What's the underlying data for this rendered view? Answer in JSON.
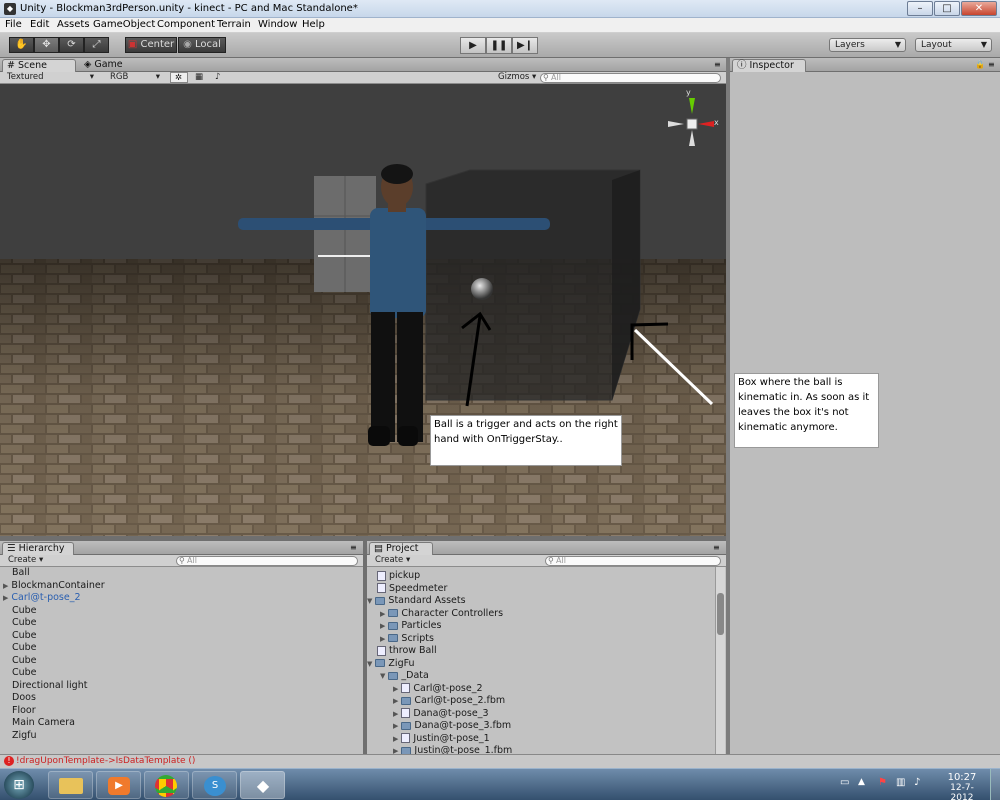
{
  "window": {
    "title": "Unity - Blockman3rdPerson.unity - kinect - PC and Mac Standalone*",
    "buttons": {
      "minimize": "–",
      "maximize": "□",
      "close": "✕"
    }
  },
  "menu": [
    "File",
    "Edit",
    "Assets",
    "GameObject",
    "Component",
    "Terrain",
    "Window",
    "Help"
  ],
  "toolbar": {
    "pivot_label": "Center",
    "space_label": "Local",
    "layers_label": "Layers",
    "layout_label": "Layout"
  },
  "scene_panel": {
    "tabs": [
      "Scene",
      "Game"
    ],
    "render_mode": "Textured",
    "color_mode": "RGB",
    "gizmos_label": "Gizmos",
    "search_placeholder": "All",
    "gizmo_x_label": "x",
    "gizmo_y_label": "y"
  },
  "inspector": {
    "tab": "Inspector"
  },
  "annotations": {
    "ball_note": "Ball is a trigger and acts on the right hand with OnTriggerStay..",
    "box_note": "Box where the ball is kinematic in. As soon as it leaves the box it's not kinematic anymore."
  },
  "hierarchy": {
    "tab": "Hierarchy",
    "create_label": "Create",
    "search_placeholder": "All",
    "items": [
      {
        "label": "Ball",
        "expandable": false,
        "selected": false
      },
      {
        "label": "BlockmanContainer",
        "expandable": true,
        "selected": false
      },
      {
        "label": "Carl@t-pose_2",
        "expandable": true,
        "selected": true
      },
      {
        "label": "Cube",
        "expandable": false,
        "selected": false
      },
      {
        "label": "Cube",
        "expandable": false,
        "selected": false
      },
      {
        "label": "Cube",
        "expandable": false,
        "selected": false
      },
      {
        "label": "Cube",
        "expandable": false,
        "selected": false
      },
      {
        "label": "Cube",
        "expandable": false,
        "selected": false
      },
      {
        "label": "Cube",
        "expandable": false,
        "selected": false
      },
      {
        "label": "Directional light",
        "expandable": false,
        "selected": false
      },
      {
        "label": "Doos",
        "expandable": false,
        "selected": false
      },
      {
        "label": "Floor",
        "expandable": false,
        "selected": false
      },
      {
        "label": "Main Camera",
        "expandable": false,
        "selected": false
      },
      {
        "label": "Zigfu",
        "expandable": false,
        "selected": false
      }
    ]
  },
  "project": {
    "tab": "Project",
    "create_label": "Create",
    "search_placeholder": "All",
    "items": [
      {
        "label": "pickup",
        "depth": 0,
        "kind": "asset"
      },
      {
        "label": "Speedmeter",
        "depth": 0,
        "kind": "asset"
      },
      {
        "label": "Standard Assets",
        "depth": 0,
        "kind": "folder-open"
      },
      {
        "label": "Character Controllers",
        "depth": 1,
        "kind": "folder"
      },
      {
        "label": "Particles",
        "depth": 1,
        "kind": "folder"
      },
      {
        "label": "Scripts",
        "depth": 1,
        "kind": "folder"
      },
      {
        "label": "throw Ball",
        "depth": 0,
        "kind": "asset"
      },
      {
        "label": "ZigFu",
        "depth": 0,
        "kind": "folder-open"
      },
      {
        "label": "_Data",
        "depth": 1,
        "kind": "folder-open"
      },
      {
        "label": "Carl@t-pose_2",
        "depth": 2,
        "kind": "model"
      },
      {
        "label": "Carl@t-pose_2.fbm",
        "depth": 2,
        "kind": "folder"
      },
      {
        "label": "Dana@t-pose_3",
        "depth": 2,
        "kind": "model"
      },
      {
        "label": "Dana@t-pose_3.fbm",
        "depth": 2,
        "kind": "folder"
      },
      {
        "label": "Justin@t-pose_1",
        "depth": 2,
        "kind": "model"
      },
      {
        "label": "Justin@t-pose_1.fbm",
        "depth": 2,
        "kind": "folder"
      }
    ]
  },
  "status": {
    "message": "!dragUponTemplate->IsDataTemplate ()"
  },
  "taskbar": {
    "time": "10:27",
    "date": "12-7-2012"
  }
}
